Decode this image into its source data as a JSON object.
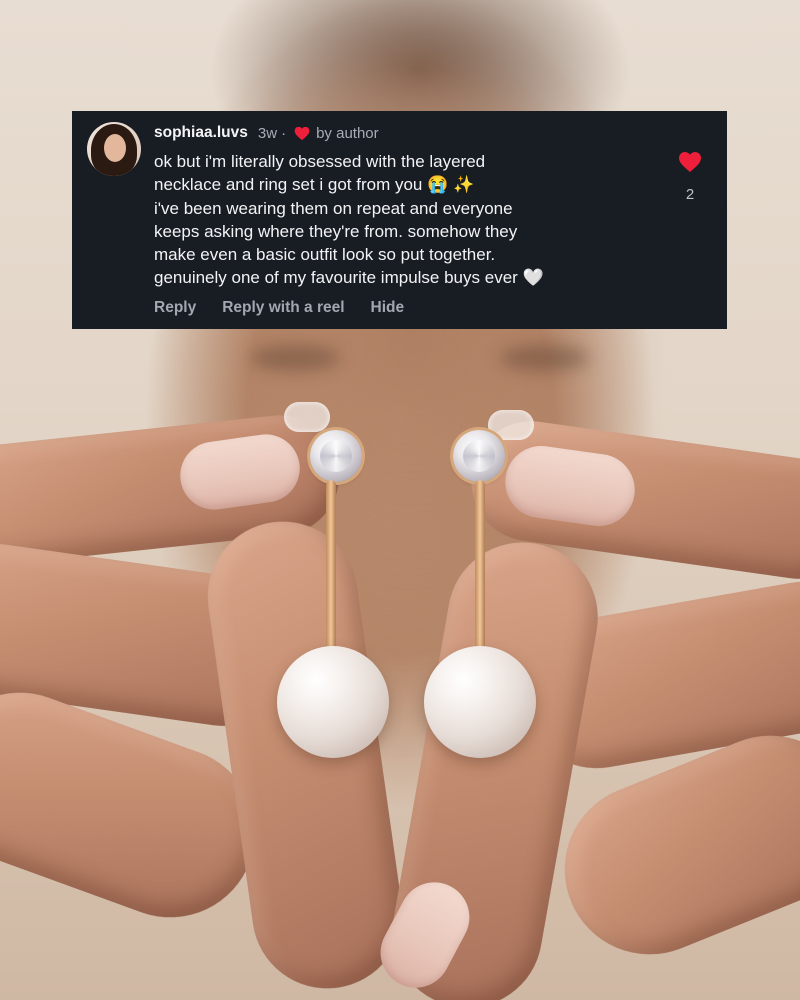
{
  "comment": {
    "username": "sophiaa.luvs",
    "time_ago": "3w",
    "separator": "·",
    "liked_by_author_text": "by author",
    "lines": [
      "ok but i'm literally obsessed with the layered",
      "necklace and ring set i got from you 😭 ✨",
      "i've been wearing them on repeat and everyone",
      "keeps asking where they're from. somehow they",
      "make even a basic outfit look so put together.",
      "genuinely one of my favourite impulse buys ever 🤍"
    ],
    "like_count": "2",
    "actions": {
      "reply": "Reply",
      "reply_with_reel": "Reply with a reel",
      "hide": "Hide"
    },
    "colors": {
      "card_background": "#181c23",
      "heart": "#ed1f3a",
      "primary_text": "#f2f3f5",
      "secondary_text": "#a3a8b0"
    },
    "icons": [
      "avatar-photo",
      "heart-icon",
      "like-heart-icon"
    ]
  }
}
